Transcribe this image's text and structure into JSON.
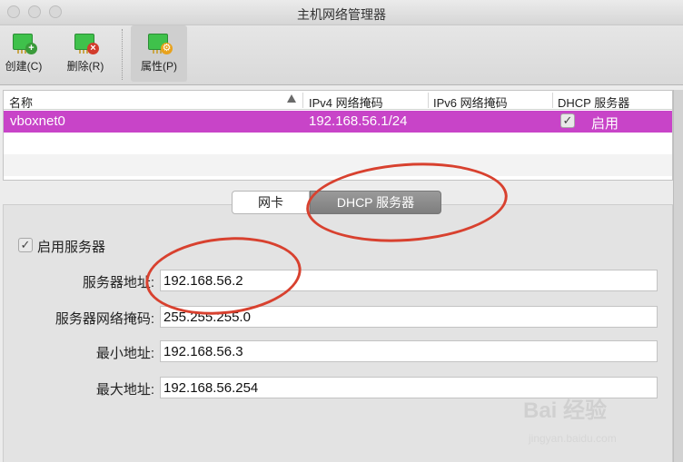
{
  "window": {
    "title": "主机网络管理器"
  },
  "toolbar": {
    "create_label": "创建(C)",
    "delete_label": "删除(R)",
    "properties_label": "属性(P)"
  },
  "table": {
    "headers": [
      "名称",
      "IPv4 网络掩码",
      "IPv6 网络掩码",
      "DHCP 服务器"
    ],
    "rows": [
      {
        "name": "vboxnet0",
        "ipv4": "192.168.56.1/24",
        "ipv6": "",
        "dhcp_checked": true,
        "dhcp": "启用"
      }
    ]
  },
  "tabs": {
    "adapter": "网卡",
    "dhcp": "DHCP 服务器",
    "selected": "dhcp"
  },
  "dhcp": {
    "enable_label": "启用服务器",
    "enabled": true,
    "server_address_label": "服务器地址:",
    "server_address": "192.168.56.2",
    "server_mask_label": "服务器网络掩码:",
    "server_mask": "255.255.255.0",
    "lower_address_label": "最小地址:",
    "lower_address": "192.168.56.3",
    "upper_address_label": "最大地址:",
    "upper_address": "192.168.56.254"
  },
  "watermark": {
    "brand": "Bai 经验",
    "url": "jingyan.baidu.com"
  },
  "colors": {
    "selection": "#c844c8",
    "annotation": "#d8412f"
  }
}
